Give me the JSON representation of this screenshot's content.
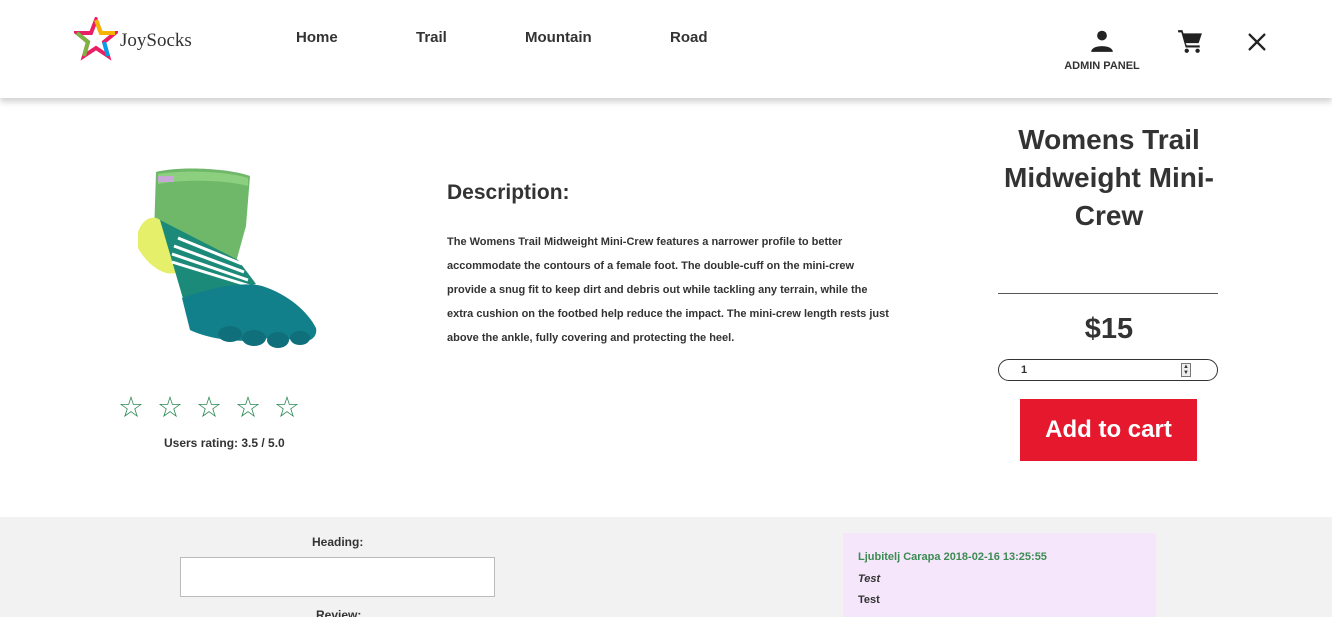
{
  "header": {
    "logo_text": "JoySocks",
    "nav": [
      {
        "label": "Home"
      },
      {
        "label": "Trail"
      },
      {
        "label": "Mountain"
      },
      {
        "label": "Road"
      }
    ],
    "admin_label": "ADMIN PANEL",
    "icons": {
      "user": "user-icon",
      "cart": "cart-icon",
      "close": "close-icon"
    }
  },
  "product": {
    "title": "Womens Trail Midweight Mini-Crew",
    "price": "$15",
    "quantity": "1",
    "add_to_cart_label": "Add to cart",
    "rating_text": "Users rating:  3.5 / 5.0",
    "rating_value": 3.5,
    "rating_max": 5,
    "description_heading": "Description:",
    "description": "The Womens Trail Midweight Mini-Crew features a narrower profile to better accommodate the contours of a female foot. The double-cuff on the mini-crew provide a snug fit to keep dirt and debris out while tackling any terrain, while the extra cushion on the footbed help reduce the impact. The mini-crew length rests just above the ankle, fully covering and protecting the heel."
  },
  "review_form": {
    "heading_label": "Heading:",
    "heading_value": "",
    "review_label": "Review:"
  },
  "reviews": [
    {
      "meta": "Ljubitelj Carapa 2018-02-16 13:25:55",
      "title": "Test",
      "body": "Test"
    }
  ],
  "colors": {
    "accent_red": "#e5182e",
    "star_green": "#2e8b57",
    "review_meta_green": "#3b8b52",
    "review_card_bg": "#f5e6fb",
    "section_bg": "#f2f2f2"
  }
}
